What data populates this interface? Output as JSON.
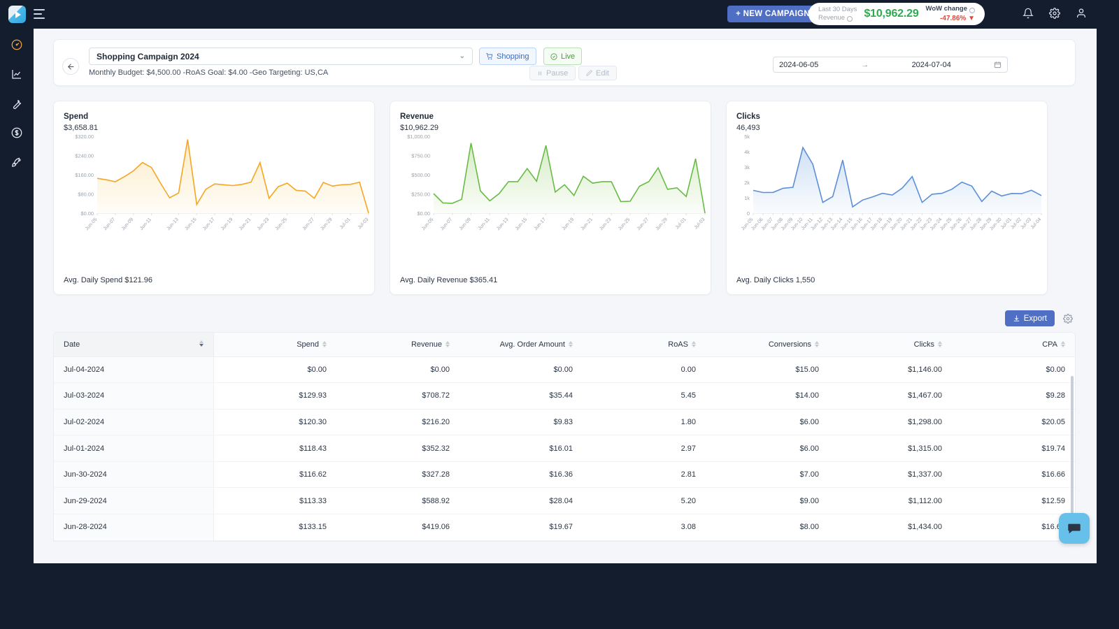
{
  "topbar": {
    "logo_name": "play-logo",
    "menu_icon": "hamburger-icon",
    "new_campaign_label": "+ NEW CAMPAIGN",
    "revenue_pill": {
      "label_line1": "Last 30 Days",
      "label_line2": "Revenue",
      "amount": "$10,962.29",
      "wow_label": "WoW change",
      "wow_value": "-47.86%",
      "amount_color": "#2eab4f",
      "wow_color": "#e0483b"
    },
    "icons": [
      "bell-icon",
      "gear-icon",
      "user-icon"
    ]
  },
  "sidebar": {
    "items": [
      {
        "icon": "gauge-icon",
        "name": "dashboard",
        "active": true
      },
      {
        "icon": "line-chart-icon",
        "name": "analytics",
        "active": false
      },
      {
        "icon": "wrench-icon",
        "name": "tools",
        "active": false
      },
      {
        "icon": "dollar-circle-icon",
        "name": "billing",
        "active": false
      },
      {
        "icon": "rocket-icon",
        "name": "launch",
        "active": false
      }
    ],
    "active_color": "#e8a33d"
  },
  "campaign_header": {
    "back_icon": "arrow-left-icon",
    "name": "Shopping Campaign 2024",
    "type_chip": {
      "label": "Shopping",
      "icon": "cart-icon"
    },
    "status_chip": {
      "label": "Live",
      "icon": "check-circle-icon"
    },
    "meta": "Monthly Budget: $4,500.00 -RoAS Goal: $4.00 -Geo Targeting: US,CA",
    "pause_label": "Pause",
    "edit_label": "Edit",
    "date_start": "2024-06-05",
    "date_arrow": "→",
    "date_end": "2024-07-04",
    "calendar_icon": "calendar-icon"
  },
  "charts": [
    {
      "title": "Spend",
      "value": "$3,658.81",
      "footer": "Avg. Daily Spend $121.96",
      "color": "#f5a623",
      "fill_top": "#fdebc6",
      "fill_bottom": "#fffdf8"
    },
    {
      "title": "Revenue",
      "value": "$10,962.29",
      "footer": "Avg. Daily Revenue $365.41",
      "color": "#68bb45",
      "fill_top": "#d5ecc5",
      "fill_bottom": "#fbfdf9"
    },
    {
      "title": "Clicks",
      "value": "46,493",
      "footer": "Avg. Daily Clicks 1,550",
      "color": "#5b8fd6",
      "fill_top": "#cfe0f5",
      "fill_bottom": "#fafcfe"
    }
  ],
  "chart_data": [
    {
      "type": "area",
      "title": "Spend",
      "xlabel": "",
      "ylabel": "",
      "ylim": [
        0,
        320
      ],
      "ytick_labels": [
        "$320.00",
        "$240.00",
        "$160.00",
        "$80.00",
        "$0.00"
      ],
      "ytick_values": [
        320,
        240,
        160,
        80,
        0
      ],
      "grid": false,
      "x": [
        "Jun-05",
        "Jun-06",
        "Jun-07",
        "Jun-08",
        "Jun-09",
        "Jun-10",
        "Jun-11",
        "Jun-12",
        "Jun-13",
        "Jun-14",
        "Jun-15",
        "Jun-16",
        "Jun-17",
        "Jun-18",
        "Jun-19",
        "Jun-20",
        "Jun-21",
        "Jun-22",
        "Jun-23",
        "Jun-24",
        "Jun-25",
        "Jun-26",
        "Jun-27",
        "Jun-28",
        "Jun-29",
        "Jun-30",
        "Jul-01",
        "Jul-02",
        "Jul-03",
        "Jul-04"
      ],
      "xtick_labels": [
        "Jun-05",
        "Jun-07",
        "Jun-09",
        "Jun-11",
        "Jun-13",
        "Jun-15",
        "Jun-17",
        "Jun-19",
        "Jun-21",
        "Jun-23",
        "Jun-25",
        "Jun-27",
        "Jun-29",
        "Jul-01",
        "Jul-03"
      ],
      "values": [
        145,
        139,
        131,
        152,
        176,
        211,
        190,
        125,
        64,
        84,
        307,
        36,
        99,
        122,
        118,
        115,
        120,
        129,
        211,
        62,
        110,
        125,
        95,
        92,
        62,
        128,
        113,
        118,
        120,
        129,
        0
      ]
    },
    {
      "type": "area",
      "title": "Revenue",
      "xlabel": "",
      "ylabel": "",
      "ylim": [
        0,
        1000
      ],
      "ytick_labels": [
        "$1,000.00",
        "$750.00",
        "$500.00",
        "$250.00",
        "$0.00"
      ],
      "ytick_values": [
        1000,
        750,
        500,
        250,
        0
      ],
      "grid": false,
      "x": [
        "Jun-05",
        "Jun-06",
        "Jun-07",
        "Jun-08",
        "Jun-09",
        "Jun-10",
        "Jun-11",
        "Jun-12",
        "Jun-13",
        "Jun-14",
        "Jun-15",
        "Jun-16",
        "Jun-17",
        "Jun-18",
        "Jun-19",
        "Jun-20",
        "Jun-21",
        "Jun-22",
        "Jun-23",
        "Jun-24",
        "Jun-25",
        "Jun-26",
        "Jun-27",
        "Jun-28",
        "Jun-29",
        "Jun-30",
        "Jul-01",
        "Jul-02",
        "Jul-03",
        "Jul-04"
      ],
      "xtick_labels": [
        "Jun-05",
        "Jun-07",
        "Jun-09",
        "Jun-11",
        "Jun-13",
        "Jun-15",
        "Jun-17",
        "Jun-19",
        "Jun-21",
        "Jun-23",
        "Jun-25",
        "Jun-27",
        "Jun-29",
        "Jul-01",
        "Jul-03"
      ],
      "values": [
        255,
        133,
        128,
        180,
        912,
        290,
        160,
        255,
        410,
        410,
        580,
        415,
        880,
        275,
        370,
        230,
        480,
        390,
        410,
        410,
        150,
        155,
        350,
        410,
        590,
        310,
        330,
        216,
        708,
        0
      ]
    },
    {
      "type": "area",
      "title": "Clicks",
      "xlabel": "",
      "ylabel": "",
      "ylim": [
        0,
        5000
      ],
      "ytick_labels": [
        "5k",
        "4k",
        "3k",
        "2k",
        "1k",
        "0"
      ],
      "ytick_values": [
        5000,
        4000,
        3000,
        2000,
        1000,
        0
      ],
      "grid": false,
      "x": [
        "Jun-05",
        "Jun-06",
        "Jun-07",
        "Jun-08",
        "Jun-09",
        "Jun-10",
        "Jun-11",
        "Jun-12",
        "Jun-13",
        "Jun-14",
        "Jun-15",
        "Jun-16",
        "Jun-17",
        "Jun-18",
        "Jun-19",
        "Jun-20",
        "Jun-21",
        "Jun-22",
        "Jun-23",
        "Jun-24",
        "Jun-25",
        "Jun-26",
        "Jun-27",
        "Jun-28",
        "Jun-29",
        "Jun-30",
        "Jul-01",
        "Jul-02",
        "Jul-03",
        "Jul-04"
      ],
      "xtick_labels": [
        "Jun-05",
        "Jun-06",
        "Jun-07",
        "Jun-08",
        "Jun-09",
        "Jun-10",
        "Jun-11",
        "Jun-12",
        "Jun-13",
        "Jun-14",
        "Jun-15",
        "Jun-16",
        "Jun-17",
        "Jun-18",
        "Jun-19",
        "Jun-20",
        "Jun-21",
        "Jun-22",
        "Jun-23",
        "Jun-24",
        "Jun-25",
        "Jun-26",
        "Jun-27",
        "Jun-28",
        "Jun-29",
        "Jun-30",
        "Jul-01",
        "Jul-02",
        "Jul-03",
        "Jul-04"
      ],
      "values": [
        1480,
        1340,
        1350,
        1620,
        1680,
        4270,
        3180,
        700,
        1080,
        3450,
        410,
        850,
        1060,
        1290,
        1180,
        1630,
        2380,
        700,
        1230,
        1290,
        1560,
        2020,
        1760,
        760,
        1430,
        1120,
        1280,
        1270,
        1490,
        1146
      ]
    }
  ],
  "table_tools": {
    "export_label": "Export",
    "export_icon": "download-icon",
    "settings_icon": "gear-icon"
  },
  "table": {
    "columns": [
      "Date",
      "Spend",
      "Revenue",
      "Avg. Order Amount",
      "RoAS",
      "Conversions",
      "Clicks",
      "CPA"
    ],
    "rows": [
      [
        "Jul-04-2024",
        "$0.00",
        "$0.00",
        "$0.00",
        "0.00",
        "$15.00",
        "$1,146.00",
        "$0.00"
      ],
      [
        "Jul-03-2024",
        "$129.93",
        "$708.72",
        "$35.44",
        "5.45",
        "$14.00",
        "$1,467.00",
        "$9.28"
      ],
      [
        "Jul-02-2024",
        "$120.30",
        "$216.20",
        "$9.83",
        "1.80",
        "$6.00",
        "$1,298.00",
        "$20.05"
      ],
      [
        "Jul-01-2024",
        "$118.43",
        "$352.32",
        "$16.01",
        "2.97",
        "$6.00",
        "$1,315.00",
        "$19.74"
      ],
      [
        "Jun-30-2024",
        "$116.62",
        "$327.28",
        "$16.36",
        "2.81",
        "$7.00",
        "$1,337.00",
        "$16.66"
      ],
      [
        "Jun-29-2024",
        "$113.33",
        "$588.92",
        "$28.04",
        "5.20",
        "$9.00",
        "$1,112.00",
        "$12.59"
      ],
      [
        "Jun-28-2024",
        "$133.15",
        "$419.06",
        "$19.67",
        "3.08",
        "$8.00",
        "$1,434.00",
        "$16.64"
      ]
    ]
  },
  "chat": {
    "icon": "chat-bubble-icon"
  }
}
